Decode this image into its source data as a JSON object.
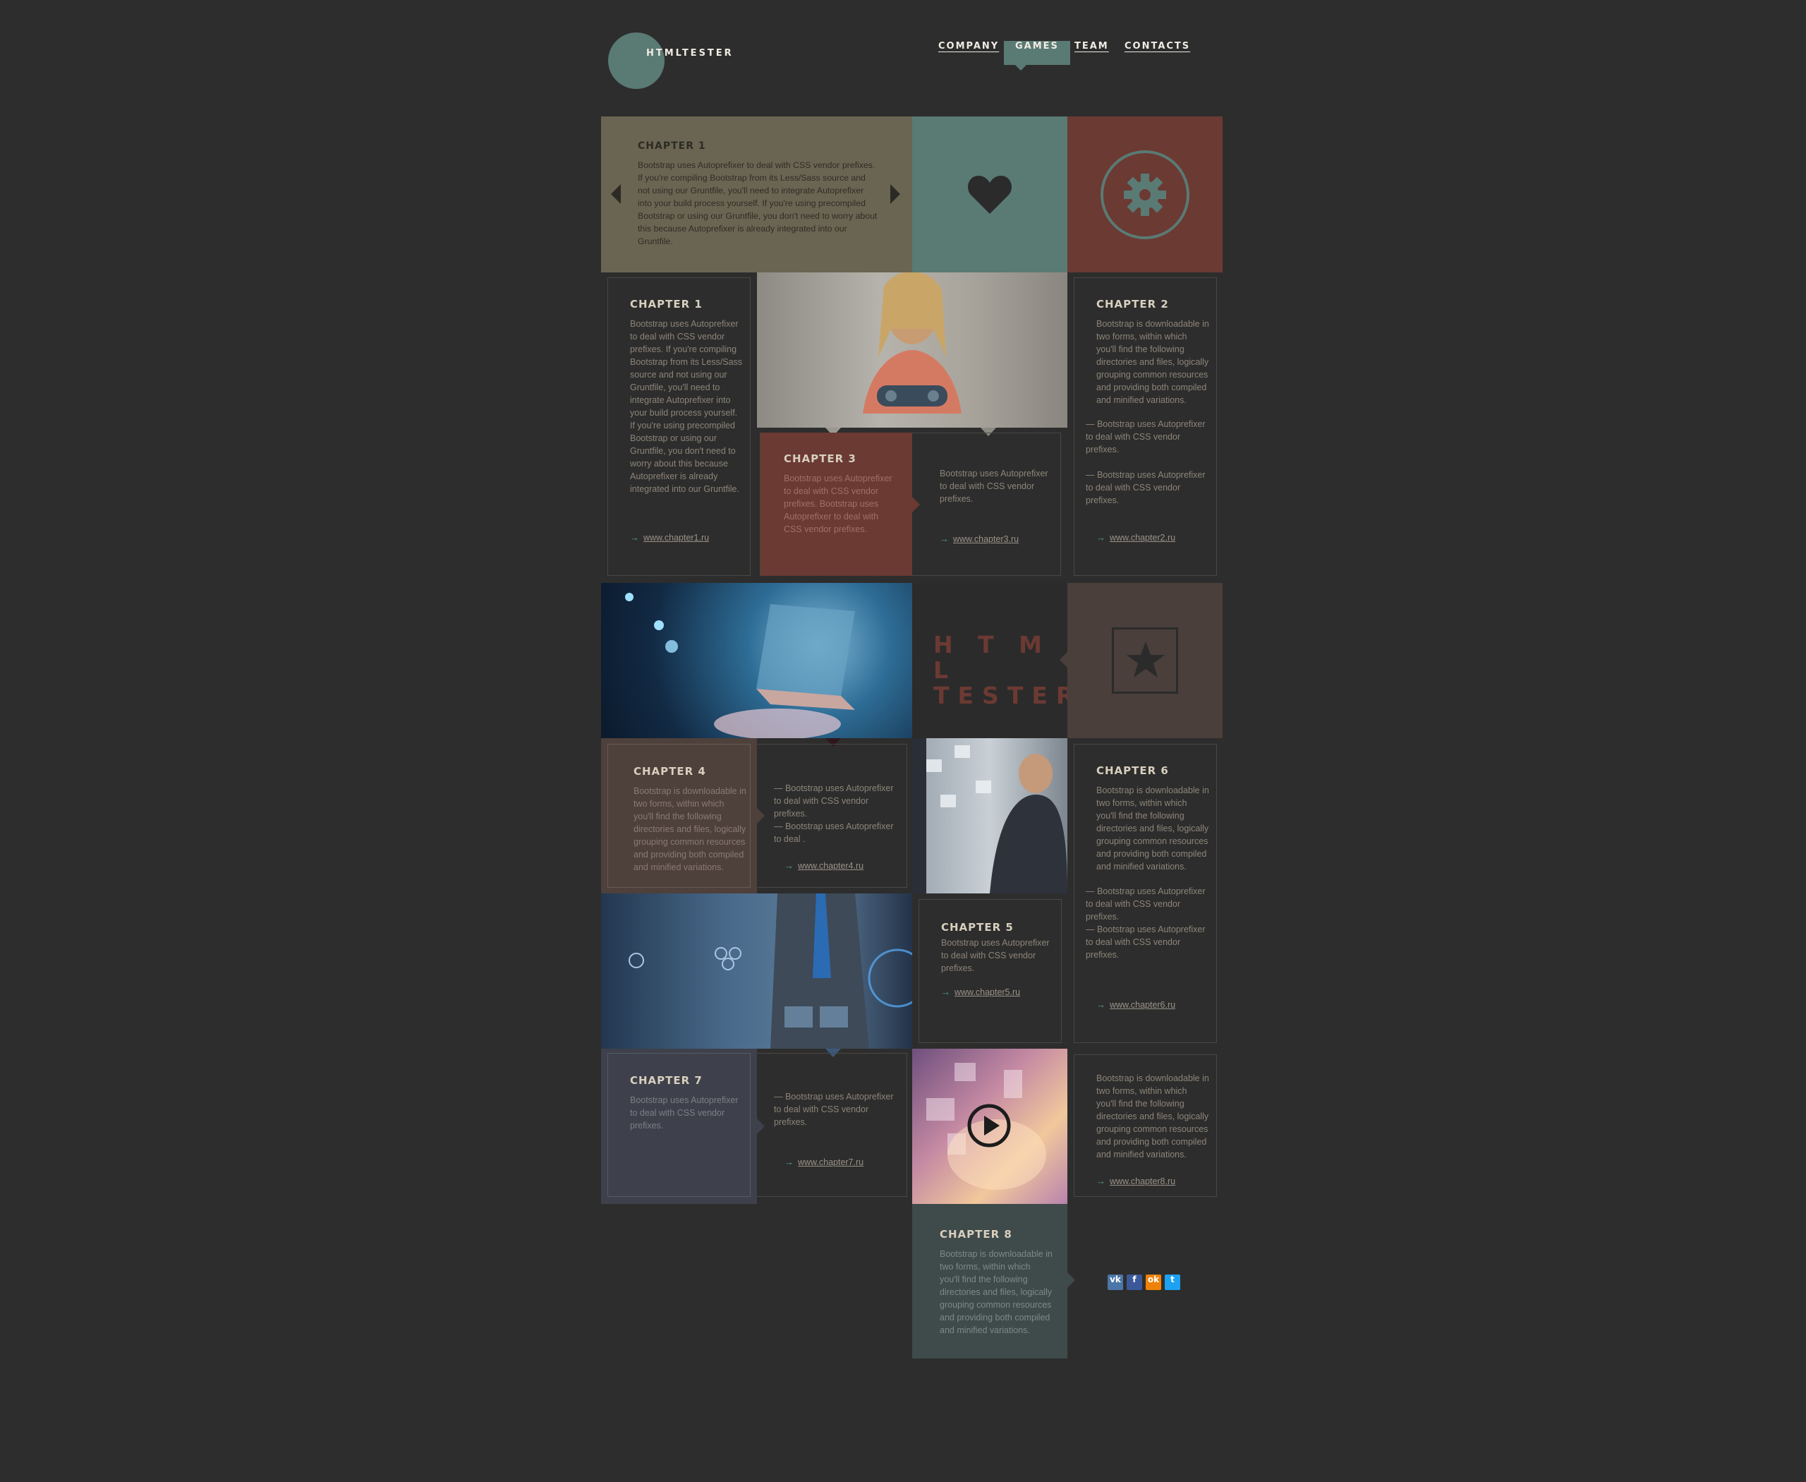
{
  "header": {
    "logo_text": "HTMLTESTER",
    "nav": [
      {
        "label": "COMPANY",
        "active": false
      },
      {
        "label": "GAMES",
        "active": true
      },
      {
        "label": "TEAM",
        "active": false
      },
      {
        "label": "CONTACTS",
        "active": false
      }
    ]
  },
  "hero": {
    "title": "CHAPTER 1",
    "text": "Bootstrap uses Autoprefixer to deal with CSS vendor prefixes. If you're compiling Bootstrap from its Less/Sass source and not using our Gruntfile, you'll need to integrate Autoprefixer into your build process yourself. If you're using precompiled Bootstrap or using our Gruntfile, you don't need to worry about this because Autoprefixer is already integrated into our Gruntfile.",
    "icons": [
      "arrow-left-icon",
      "arrow-right-icon",
      "heart-icon",
      "gear-icon"
    ]
  },
  "chapter1": {
    "title": "CHAPTER 1",
    "text": "Bootstrap uses Autoprefixer to deal with CSS vendor prefixes. If you're compiling Bootstrap from its Less/Sass source and not using our Gruntfile, you'll need to integrate Autoprefixer into your build process yourself. If you're using precompiled Bootstrap or using our Gruntfile, you don't need to worry about this because Autoprefixer is already integrated into our Gruntfile.",
    "link": "www.chapter1.ru"
  },
  "chapter2": {
    "title": "CHAPTER 2",
    "text": "Bootstrap is downloadable in two forms, within which you'll find the following directories and files, logically grouping common resources and providing both compiled and minified variations.",
    "item1": "— Bootstrap uses Autoprefixer to deal with CSS vendor prefixes.",
    "item2": "— Bootstrap uses Autoprefixer to deal with CSS vendor prefixes.",
    "link": "www.chapter2.ru"
  },
  "chapter3": {
    "title": "CHAPTER 3",
    "text": "Bootstrap uses Autoprefixer to deal with CSS vendor prefixes. Bootstrap uses Autoprefixer to deal with CSS vendor prefixes.",
    "side_text": "Bootstrap uses Autoprefixer to deal with CSS vendor prefixes.",
    "link": "www.chapter3.ru"
  },
  "brand_block": {
    "line1": "H T M L",
    "line2": "TESTER",
    "icon": "star-icon"
  },
  "chapter4": {
    "title": "CHAPTER 4",
    "text": "Bootstrap is downloadable in two forms, within which you'll find the following directories and files, logically grouping common resources and providing both compiled and minified variations.",
    "item1": "— Bootstrap uses Autoprefixer to deal with CSS vendor prefixes.",
    "item2": "— Bootstrap uses Autoprefixer to deal .",
    "link": "www.chapter4.ru"
  },
  "chapter5": {
    "title": "CHAPTER 5",
    "text": "Bootstrap uses Autoprefixer to deal with CSS vendor prefixes.",
    "link": "www.chapter5.ru"
  },
  "chapter6": {
    "title": "CHAPTER 6",
    "text": "Bootstrap is downloadable in two forms, within which you'll find the following directories and files, logically grouping common resources and providing both compiled and minified variations.",
    "item1": "— Bootstrap uses Autoprefixer to deal with CSS vendor prefixes.",
    "item2": "— Bootstrap uses Autoprefixer to deal with CSS vendor prefixes.",
    "link": "www.chapter6.ru"
  },
  "chapter7": {
    "title": "CHAPTER 7",
    "text": "Bootstrap uses Autoprefixer to deal with CSS vendor prefixes.",
    "item1": "— Bootstrap uses Autoprefixer to deal with CSS vendor prefixes.",
    "link": "www.chapter7.ru"
  },
  "chapter8_side": {
    "text": "Bootstrap is downloadable in two forms, within which you'll find the following directories and files, logically grouping common resources and providing both compiled and minified variations.",
    "link": "www.chapter8.ru"
  },
  "chapter8": {
    "title": "CHAPTER 8",
    "text": "Bootstrap is downloadable in two forms, within which you'll find the following directories and files, logically grouping common resources and providing both compiled and minified variations."
  },
  "social": [
    {
      "label": "vk",
      "icon": "vk-icon",
      "color": "#4a76a8"
    },
    {
      "label": "f",
      "icon": "facebook-icon",
      "color": "#3b5998"
    },
    {
      "label": "ok",
      "icon": "odnoklassniki-icon",
      "color": "#ee8208"
    },
    {
      "label": "t",
      "icon": "twitter-icon",
      "color": "#1da1f2"
    }
  ],
  "colors": {
    "background": "#2d2d2d",
    "teal": "#5a7a74",
    "olive": "#6a6552",
    "rust": "#6b3a33",
    "brown_block": "#4a3f3b",
    "chapter4_fill": "#4e403b",
    "chapter7_fill": "#3e414b",
    "chapter8_fill": "#3f4a4a",
    "link_arrow": "#4fa48e"
  }
}
